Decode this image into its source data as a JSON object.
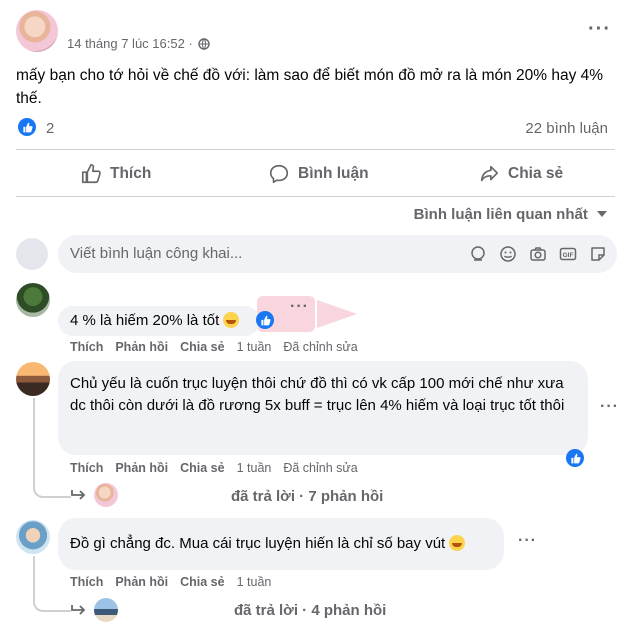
{
  "post": {
    "timestamp": "14 tháng 7 lúc 16:52 ·",
    "text": "mấy bạn cho tớ hỏi về chế đồ với: làm sao để biết món đồ mở ra là món 20% hay 4% thế.",
    "like_count": "2",
    "comment_count": "22 bình luận",
    "more_label": "···"
  },
  "actions": {
    "like": "Thích",
    "comment": "Bình luận",
    "share": "Chia sẻ"
  },
  "sort_label": "Bình luận liên quan nhất",
  "composer": {
    "placeholder": "Viết bình luận công khai..."
  },
  "comments": [
    {
      "text": "4 % là hiếm 20% là tốt",
      "like": "Thích",
      "reply": "Phản hồi",
      "share": "Chia sẻ",
      "time": "1 tuần",
      "edited": "Đã chỉnh sửa"
    },
    {
      "text": "Chủ yếu là cuốn trục luyện thôi chứ đồ thì có vk cấp 100 mới chế như xưa dc thôi còn dưới là đồ rương 5x buff = trục lên 4% hiếm và loại trục tốt thôi",
      "like": "Thích",
      "reply": "Phản hồi",
      "share": "Chia sẻ",
      "time": "1 tuần",
      "edited": "Đã chỉnh sửa",
      "replies_label": "đã trả lời · 7 phản hồi"
    },
    {
      "text": "Đồ gì chẳng đc. Mua cái trục luyện hiến là chỉ số bay vút",
      "like": "Thích",
      "reply": "Phản hồi",
      "share": "Chia sẻ",
      "time": "1 tuần",
      "replies_label": "đã trả lời · 4 phản hồi"
    }
  ],
  "colors": {
    "brand": "#1877f2",
    "secondary_text": "#65676b",
    "bubble": "#f0f2f5"
  }
}
